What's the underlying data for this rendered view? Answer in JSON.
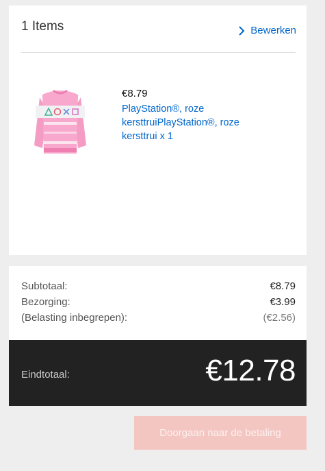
{
  "cart": {
    "items_count_label": "1 Items",
    "edit_label": "Bewerken",
    "items": [
      {
        "price": "€8.79",
        "name": "PlayStation®, roze kersttruiPlayStation®, roze kersttrui x 1",
        "image_icon": "pink-christmas-sweater"
      }
    ]
  },
  "summary": {
    "subtotal_label": "Subtotaal:",
    "subtotal_value": "€8.79",
    "shipping_label": "Bezorging:",
    "shipping_value": "€3.99",
    "tax_label": "(Belasting inbegrepen):",
    "tax_value": "(€2.56)"
  },
  "total": {
    "label": "Eindtotaal:",
    "value": "€12.78"
  },
  "checkout": {
    "button_label": "Doorgaan naar de betaling"
  },
  "colors": {
    "link": "#0066cc",
    "total_bar": "#222222",
    "checkout_button_disabled": "#f4c6c2",
    "background": "#eeeeee"
  }
}
